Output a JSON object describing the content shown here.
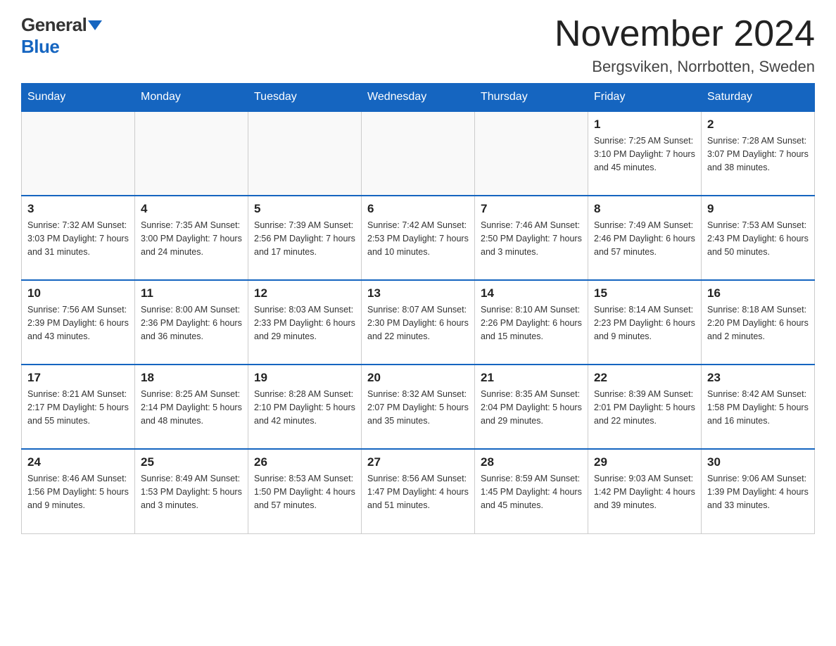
{
  "logo": {
    "general": "General",
    "blue": "Blue"
  },
  "title": "November 2024",
  "location": "Bergsviken, Norrbotten, Sweden",
  "days_of_week": [
    "Sunday",
    "Monday",
    "Tuesday",
    "Wednesday",
    "Thursday",
    "Friday",
    "Saturday"
  ],
  "weeks": [
    [
      {
        "day": "",
        "info": ""
      },
      {
        "day": "",
        "info": ""
      },
      {
        "day": "",
        "info": ""
      },
      {
        "day": "",
        "info": ""
      },
      {
        "day": "",
        "info": ""
      },
      {
        "day": "1",
        "info": "Sunrise: 7:25 AM\nSunset: 3:10 PM\nDaylight: 7 hours and 45 minutes."
      },
      {
        "day": "2",
        "info": "Sunrise: 7:28 AM\nSunset: 3:07 PM\nDaylight: 7 hours and 38 minutes."
      }
    ],
    [
      {
        "day": "3",
        "info": "Sunrise: 7:32 AM\nSunset: 3:03 PM\nDaylight: 7 hours and 31 minutes."
      },
      {
        "day": "4",
        "info": "Sunrise: 7:35 AM\nSunset: 3:00 PM\nDaylight: 7 hours and 24 minutes."
      },
      {
        "day": "5",
        "info": "Sunrise: 7:39 AM\nSunset: 2:56 PM\nDaylight: 7 hours and 17 minutes."
      },
      {
        "day": "6",
        "info": "Sunrise: 7:42 AM\nSunset: 2:53 PM\nDaylight: 7 hours and 10 minutes."
      },
      {
        "day": "7",
        "info": "Sunrise: 7:46 AM\nSunset: 2:50 PM\nDaylight: 7 hours and 3 minutes."
      },
      {
        "day": "8",
        "info": "Sunrise: 7:49 AM\nSunset: 2:46 PM\nDaylight: 6 hours and 57 minutes."
      },
      {
        "day": "9",
        "info": "Sunrise: 7:53 AM\nSunset: 2:43 PM\nDaylight: 6 hours and 50 minutes."
      }
    ],
    [
      {
        "day": "10",
        "info": "Sunrise: 7:56 AM\nSunset: 2:39 PM\nDaylight: 6 hours and 43 minutes."
      },
      {
        "day": "11",
        "info": "Sunrise: 8:00 AM\nSunset: 2:36 PM\nDaylight: 6 hours and 36 minutes."
      },
      {
        "day": "12",
        "info": "Sunrise: 8:03 AM\nSunset: 2:33 PM\nDaylight: 6 hours and 29 minutes."
      },
      {
        "day": "13",
        "info": "Sunrise: 8:07 AM\nSunset: 2:30 PM\nDaylight: 6 hours and 22 minutes."
      },
      {
        "day": "14",
        "info": "Sunrise: 8:10 AM\nSunset: 2:26 PM\nDaylight: 6 hours and 15 minutes."
      },
      {
        "day": "15",
        "info": "Sunrise: 8:14 AM\nSunset: 2:23 PM\nDaylight: 6 hours and 9 minutes."
      },
      {
        "day": "16",
        "info": "Sunrise: 8:18 AM\nSunset: 2:20 PM\nDaylight: 6 hours and 2 minutes."
      }
    ],
    [
      {
        "day": "17",
        "info": "Sunrise: 8:21 AM\nSunset: 2:17 PM\nDaylight: 5 hours and 55 minutes."
      },
      {
        "day": "18",
        "info": "Sunrise: 8:25 AM\nSunset: 2:14 PM\nDaylight: 5 hours and 48 minutes."
      },
      {
        "day": "19",
        "info": "Sunrise: 8:28 AM\nSunset: 2:10 PM\nDaylight: 5 hours and 42 minutes."
      },
      {
        "day": "20",
        "info": "Sunrise: 8:32 AM\nSunset: 2:07 PM\nDaylight: 5 hours and 35 minutes."
      },
      {
        "day": "21",
        "info": "Sunrise: 8:35 AM\nSunset: 2:04 PM\nDaylight: 5 hours and 29 minutes."
      },
      {
        "day": "22",
        "info": "Sunrise: 8:39 AM\nSunset: 2:01 PM\nDaylight: 5 hours and 22 minutes."
      },
      {
        "day": "23",
        "info": "Sunrise: 8:42 AM\nSunset: 1:58 PM\nDaylight: 5 hours and 16 minutes."
      }
    ],
    [
      {
        "day": "24",
        "info": "Sunrise: 8:46 AM\nSunset: 1:56 PM\nDaylight: 5 hours and 9 minutes."
      },
      {
        "day": "25",
        "info": "Sunrise: 8:49 AM\nSunset: 1:53 PM\nDaylight: 5 hours and 3 minutes."
      },
      {
        "day": "26",
        "info": "Sunrise: 8:53 AM\nSunset: 1:50 PM\nDaylight: 4 hours and 57 minutes."
      },
      {
        "day": "27",
        "info": "Sunrise: 8:56 AM\nSunset: 1:47 PM\nDaylight: 4 hours and 51 minutes."
      },
      {
        "day": "28",
        "info": "Sunrise: 8:59 AM\nSunset: 1:45 PM\nDaylight: 4 hours and 45 minutes."
      },
      {
        "day": "29",
        "info": "Sunrise: 9:03 AM\nSunset: 1:42 PM\nDaylight: 4 hours and 39 minutes."
      },
      {
        "day": "30",
        "info": "Sunrise: 9:06 AM\nSunset: 1:39 PM\nDaylight: 4 hours and 33 minutes."
      }
    ]
  ]
}
